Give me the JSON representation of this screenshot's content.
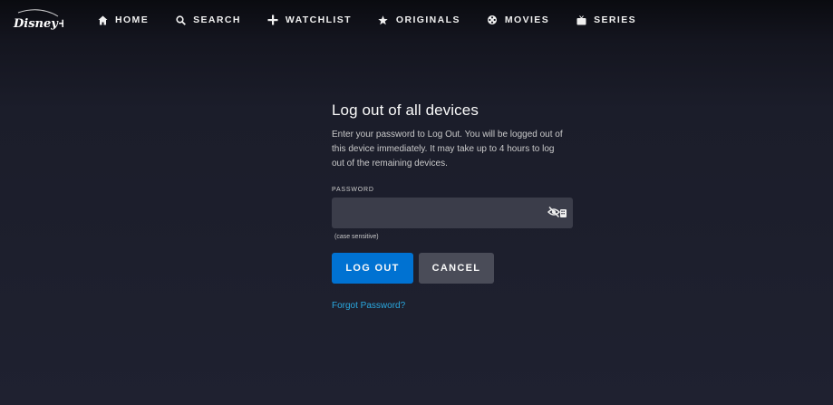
{
  "header": {
    "logo_text": "Disney+",
    "nav": [
      {
        "label": "HOME",
        "icon": "home-icon"
      },
      {
        "label": "SEARCH",
        "icon": "search-icon"
      },
      {
        "label": "WATCHLIST",
        "icon": "plus-icon"
      },
      {
        "label": "ORIGINALS",
        "icon": "star-icon"
      },
      {
        "label": "MOVIES",
        "icon": "film-reel-icon"
      },
      {
        "label": "SERIES",
        "icon": "tv-icon"
      }
    ]
  },
  "main": {
    "title": "Log out of all devices",
    "description": "Enter your password to Log Out. You will be logged out of this device immediately. It may take up to 4 hours to log out of the remaining devices.",
    "password_label": "PASSWORD",
    "password_value": "",
    "password_hint": "(case sensitive)",
    "logout_label": "LOG OUT",
    "cancel_label": "CANCEL",
    "forgot_label": "Forgot Password?"
  },
  "colors": {
    "background": "#1a1d29",
    "primary_button": "#0072d2",
    "secondary_button": "#4a4c58",
    "input_background": "#3b3d4a",
    "link": "#2aa9e0"
  }
}
